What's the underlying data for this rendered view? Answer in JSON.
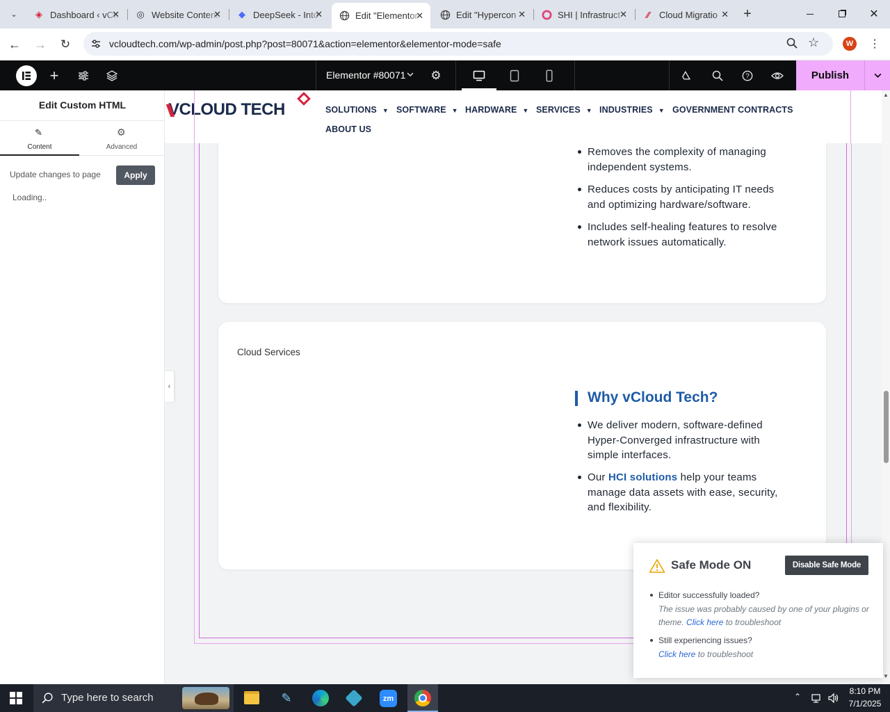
{
  "browser": {
    "tabs": [
      {
        "title": "Dashboard ‹ vCloud",
        "active": false
      },
      {
        "title": "Website Content",
        "active": false
      },
      {
        "title": "DeepSeek - Into",
        "active": false
      },
      {
        "title": "Edit \"Elementor",
        "active": true
      },
      {
        "title": "Edit \"Hypercon",
        "active": false
      },
      {
        "title": "SHI | Infrastruct",
        "active": false
      },
      {
        "title": "Cloud Migratio",
        "active": false
      }
    ],
    "url": "vcloudtech.com/wp-admin/post.php?post=80071&action=elementor&elementor-mode=safe",
    "profile_initial": "W"
  },
  "elementor": {
    "document_title": "Elementor #80071",
    "publish_label": "Publish",
    "panel": {
      "title": "Edit Custom HTML",
      "tab_content": "Content",
      "tab_advanced": "Advanced",
      "update_label": "Update changes to page",
      "apply_label": "Apply",
      "loading": "Loading.."
    }
  },
  "site": {
    "logo_text": "VCLOUD TECH",
    "nav": [
      {
        "label": "SOLUTIONS",
        "dropdown": true
      },
      {
        "label": "SOFTWARE",
        "dropdown": true
      },
      {
        "label": "HARDWARE",
        "dropdown": true
      },
      {
        "label": "SERVICES",
        "dropdown": true
      },
      {
        "label": "INDUSTRIES",
        "dropdown": true
      },
      {
        "label": "GOVERNMENT CONTRACTS",
        "dropdown": false
      },
      {
        "label": "ABOUT US",
        "dropdown": false
      }
    ],
    "card1_bullets": [
      "Removes the complexity of managing independent systems.",
      "Reduces costs by anticipating IT needs and optimizing hardware/software.",
      "Includes self-healing features to resolve network issues automatically."
    ],
    "card2": {
      "image_alt": "Cloud Services",
      "heading": "Why vCloud Tech?",
      "bullet1": "We deliver modern, software-defined Hyper-Converged infrastructure with simple interfaces.",
      "bullet2_pre": "Our ",
      "bullet2_link": "HCI solutions",
      "bullet2_post": " help your teams manage data assets with ease, security, and flexibility."
    }
  },
  "safe_mode": {
    "title": "Safe Mode ON",
    "disable_label": "Disable Safe Mode",
    "item1_head": "Editor successfully loaded?",
    "item1_text": "The issue was probably caused by one of your plugins or theme.",
    "item1_link": "Click here",
    "item1_tail": " to troubleshoot",
    "item2_head": "Still experiencing issues?",
    "item2_link": "Click here",
    "item2_tail": " to troubleshoot"
  },
  "taskbar": {
    "search_placeholder": "Type here to search",
    "time": "8:10 PM",
    "date": "7/1/2025"
  },
  "colors": {
    "accent_link": "#1e5ba8",
    "publish": "#f0abfc",
    "elementor_bar": "#0c0d0e",
    "safe_button": "#3f444b"
  }
}
